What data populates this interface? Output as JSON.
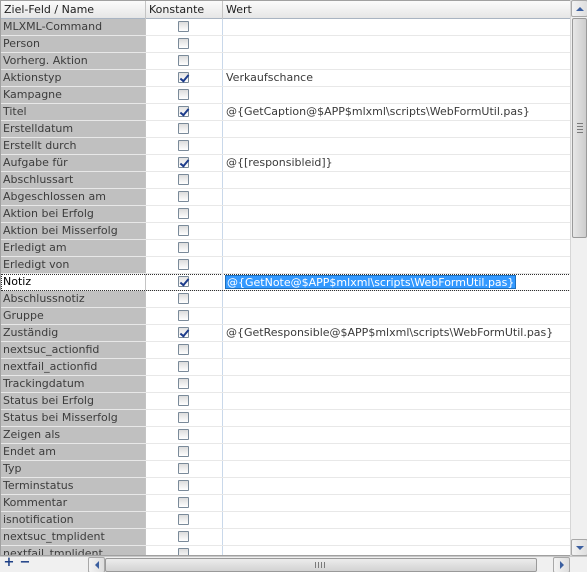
{
  "columns": {
    "field": "Ziel-Feld / Name",
    "constant": "Konstante",
    "value": "Wert"
  },
  "rows": [
    {
      "name": "MLXML-Command",
      "constant": false,
      "value": ""
    },
    {
      "name": "Person",
      "constant": false,
      "value": ""
    },
    {
      "name": "Vorherg. Aktion",
      "constant": false,
      "value": ""
    },
    {
      "name": "Aktionstyp",
      "constant": true,
      "value": "Verkaufschance"
    },
    {
      "name": "Kampagne",
      "constant": false,
      "value": ""
    },
    {
      "name": "Titel",
      "constant": true,
      "value": "@{GetCaption@$APP$mlxml\\scripts\\WebFormUtil.pas}"
    },
    {
      "name": "Erstelldatum",
      "constant": false,
      "value": ""
    },
    {
      "name": "Erstellt durch",
      "constant": false,
      "value": ""
    },
    {
      "name": "Aufgabe für",
      "constant": true,
      "value": "@{[responsibleid]}"
    },
    {
      "name": "Abschlussart",
      "constant": false,
      "value": ""
    },
    {
      "name": "Abgeschlossen am",
      "constant": false,
      "value": ""
    },
    {
      "name": "Aktion bei Erfolg",
      "constant": false,
      "value": ""
    },
    {
      "name": "Aktion bei Misserfolg",
      "constant": false,
      "value": ""
    },
    {
      "name": "Erledigt am",
      "constant": false,
      "value": ""
    },
    {
      "name": "Erledigt von",
      "constant": false,
      "value": ""
    },
    {
      "name": "Notiz",
      "constant": true,
      "value": "@{GetNote@$APP$mlxml\\scripts\\WebFormUtil.pas}",
      "selected": true
    },
    {
      "name": "Abschlussnotiz",
      "constant": false,
      "value": ""
    },
    {
      "name": "Gruppe",
      "constant": false,
      "value": ""
    },
    {
      "name": "Zuständig",
      "constant": true,
      "value": "@{GetResponsible@$APP$mlxml\\scripts\\WebFormUtil.pas}"
    },
    {
      "name": "nextsuc_actionfid",
      "constant": false,
      "value": ""
    },
    {
      "name": "nextfail_actionfid",
      "constant": false,
      "value": ""
    },
    {
      "name": "Trackingdatum",
      "constant": false,
      "value": ""
    },
    {
      "name": "Status bei Erfolg",
      "constant": false,
      "value": ""
    },
    {
      "name": "Status bei Misserfolg",
      "constant": false,
      "value": ""
    },
    {
      "name": "Zeigen als",
      "constant": false,
      "value": ""
    },
    {
      "name": "Endet am",
      "constant": false,
      "value": ""
    },
    {
      "name": "Typ",
      "constant": false,
      "value": ""
    },
    {
      "name": "Terminstatus",
      "constant": false,
      "value": ""
    },
    {
      "name": "Kommentar",
      "constant": false,
      "value": ""
    },
    {
      "name": "isnotification",
      "constant": false,
      "value": ""
    },
    {
      "name": "nextsuc_tmplident",
      "constant": false,
      "value": ""
    },
    {
      "name": "nextfail_tmplident",
      "constant": false,
      "value": ""
    }
  ],
  "toolbar": {
    "add_label": "+",
    "remove_label": "−"
  },
  "icons": {
    "add": "plus-icon",
    "remove": "minus-icon"
  },
  "colors": {
    "name_column_bg": "#c0c0c0",
    "selection": "#3399ff",
    "check": "#1c3c8c"
  }
}
